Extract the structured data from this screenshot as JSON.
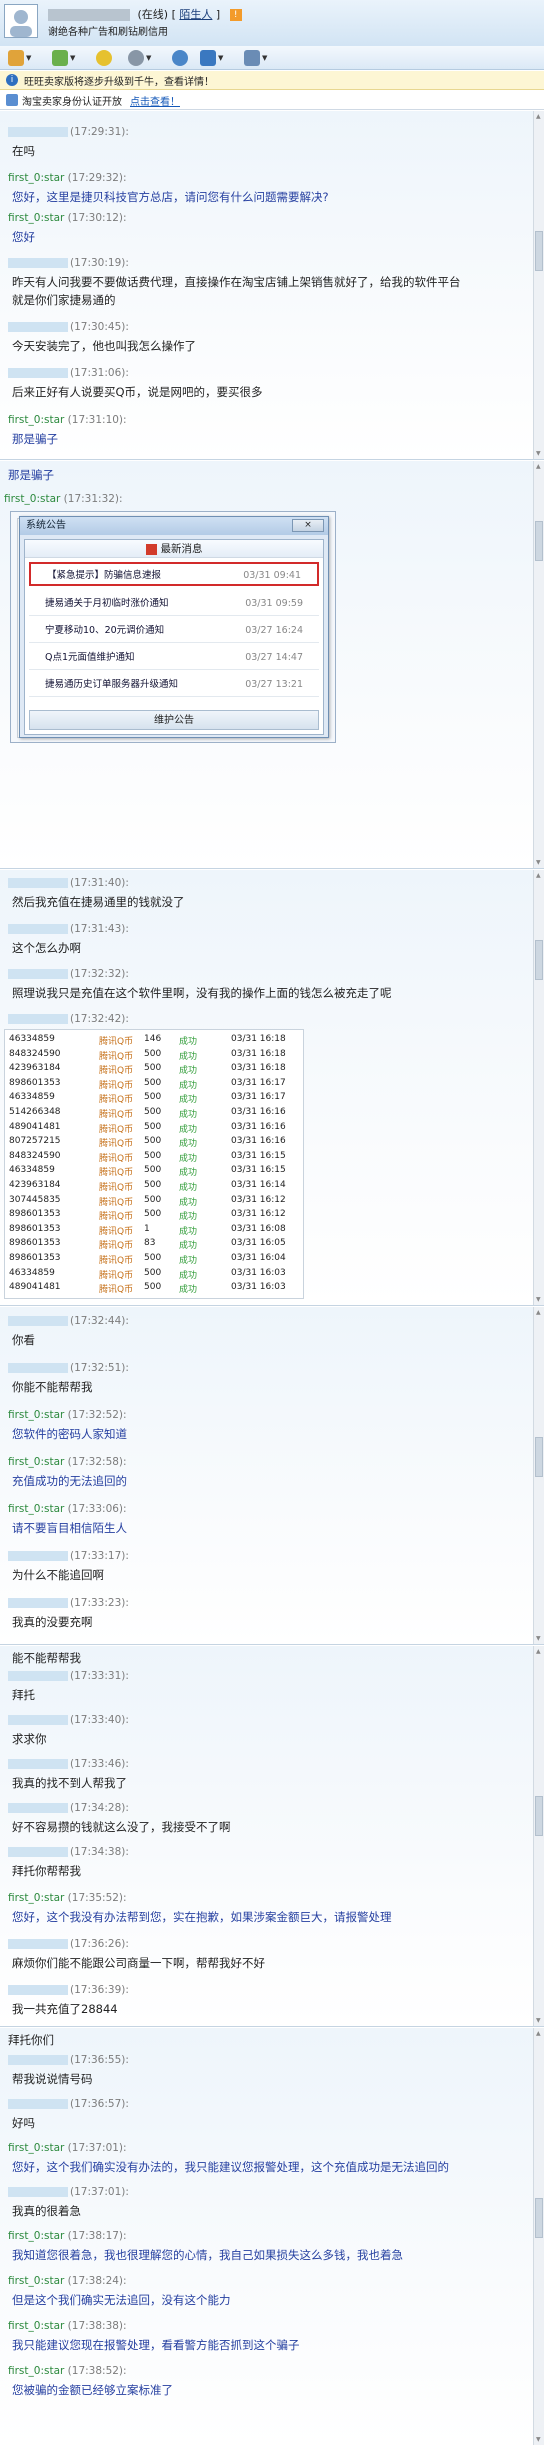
{
  "header": {
    "status": "(在线)",
    "stranger_label": "陌生人",
    "signature": "谢绝各种广告和刷钻刷信用"
  },
  "banner": {
    "text": "旺旺卖家版将逐步升级到千牛，查看详情！"
  },
  "banner2": {
    "text": "淘宝卖家身份认证开放",
    "link": "点击查看！"
  },
  "sections": [
    {
      "messages": [
        {
          "sender": "",
          "time": "(17:29:31):",
          "text": "在吗",
          "role": "me"
        },
        {
          "sender": "first_0:star",
          "time": "(17:29:32):",
          "text": "您好，这里是捷贝科技官方总店，请问您有什么问题需要解决?",
          "role": "star"
        },
        {
          "sender": "first_0:star",
          "time": "(17:30:12):",
          "text": "您好",
          "role": "star"
        },
        {
          "sender": "",
          "time": "(17:30:19):",
          "text": "昨天有人问我要不要做话费代理，直接操作在淘宝店铺上架销售就好了，给我的软件平台",
          "text2": "就是你们家捷易通的",
          "role": "me"
        },
        {
          "sender": "",
          "time": "(17:30:45):",
          "text": "今天安装完了，他也叫我怎么操作了",
          "role": "me"
        },
        {
          "sender": "",
          "time": "(17:31:06):",
          "text": "后来正好有人说要买Q币，说是网吧的，要买很多",
          "role": "me"
        },
        {
          "sender": "first_0:star",
          "time": "(17:31:10):",
          "text": "那是骗子",
          "role": "star"
        }
      ]
    },
    {
      "messages": [
        {
          "text": "那是骗子",
          "role": "star-text"
        },
        {
          "sender": "first_0:star",
          "time": "(17:31:32):",
          "role": "star"
        }
      ],
      "popup": {
        "title": "系统公告",
        "close": "×",
        "head": "最新消息",
        "foot": "维护公告",
        "items": [
          {
            "title": "【紧急提示】防骗信息速报",
            "date": "03/31 09:41"
          },
          {
            "title": "捷易通关于月初临时涨价通知",
            "date": "03/31 09:59"
          },
          {
            "title": "宁夏移动10、20元调价通知",
            "date": "03/27 16:24"
          },
          {
            "title": "Q点1元面值维护通知",
            "date": "03/27 14:47"
          },
          {
            "title": "捷易通历史订单服务器升级通知",
            "date": "03/27 13:21"
          }
        ]
      }
    },
    {
      "messages": [
        {
          "sender": "",
          "time": "(17:31:40):",
          "text": "然后我充值在捷易通里的钱就没了",
          "role": "me"
        },
        {
          "sender": "",
          "time": "(17:31:43):",
          "text": "这个怎么办啊",
          "role": "me"
        },
        {
          "sender": "",
          "time": "(17:32:32):",
          "text": "照理说我只是充值在这个软件里啊，没有我的操作上面的钱怎么被充走了呢",
          "role": "me"
        },
        {
          "sender": "",
          "time": "(17:32:42):",
          "role": "me"
        }
      ],
      "table": [
        [
          "46334859",
          "腾讯Q币",
          "146",
          "成功",
          "03/31 16:18"
        ],
        [
          "848324590",
          "腾讯Q币",
          "500",
          "成功",
          "03/31 16:18"
        ],
        [
          "423963184",
          "腾讯Q币",
          "500",
          "成功",
          "03/31 16:18"
        ],
        [
          "898601353",
          "腾讯Q币",
          "500",
          "成功",
          "03/31 16:17"
        ],
        [
          "46334859",
          "腾讯Q币",
          "500",
          "成功",
          "03/31 16:17"
        ],
        [
          "514266348",
          "腾讯Q币",
          "500",
          "成功",
          "03/31 16:16"
        ],
        [
          "489041481",
          "腾讯Q币",
          "500",
          "成功",
          "03/31 16:16"
        ],
        [
          "807257215",
          "腾讯Q币",
          "500",
          "成功",
          "03/31 16:16"
        ],
        [
          "848324590",
          "腾讯Q币",
          "500",
          "成功",
          "03/31 16:15"
        ],
        [
          "46334859",
          "腾讯Q币",
          "500",
          "成功",
          "03/31 16:15"
        ],
        [
          "423963184",
          "腾讯Q币",
          "500",
          "成功",
          "03/31 16:14"
        ],
        [
          "307445835",
          "腾讯Q币",
          "500",
          "成功",
          "03/31 16:12"
        ],
        [
          "898601353",
          "腾讯Q币",
          "500",
          "成功",
          "03/31 16:12"
        ],
        [
          "898601353",
          "腾讯Q币",
          "1",
          "成功",
          "03/31 16:08"
        ],
        [
          "898601353",
          "腾讯Q币",
          "83",
          "成功",
          "03/31 16:05"
        ],
        [
          "898601353",
          "腾讯Q币",
          "500",
          "成功",
          "03/31 16:04"
        ],
        [
          "46334859",
          "腾讯Q币",
          "500",
          "成功",
          "03/31 16:03"
        ],
        [
          "489041481",
          "腾讯Q币",
          "500",
          "成功",
          "03/31 16:03"
        ]
      ]
    },
    {
      "messages": [
        {
          "sender": "",
          "time": "(17:32:44):",
          "text": "你看",
          "role": "me"
        },
        {
          "sender": "",
          "time": "(17:32:51):",
          "text": "你能不能帮帮我",
          "role": "me"
        },
        {
          "sender": "first_0:star",
          "time": "(17:32:52):",
          "text": "您软件的密码人家知道",
          "role": "star"
        },
        {
          "sender": "first_0:star",
          "time": "(17:32:58):",
          "text": "充值成功的无法追回的",
          "role": "star"
        },
        {
          "sender": "first_0:star",
          "time": "(17:33:06):",
          "text": "请不要盲目相信陌生人",
          "role": "star"
        },
        {
          "sender": "",
          "time": "(17:33:17):",
          "text": "为什么不能追回啊",
          "role": "me"
        },
        {
          "sender": "",
          "time": "(17:33:23):",
          "text": "我真的没要充啊",
          "role": "me"
        }
      ]
    },
    {
      "messages": [
        {
          "text": "能不能帮帮我",
          "role": "me-text"
        },
        {
          "sender": "",
          "time": "(17:33:31):",
          "text": "拜托",
          "role": "me"
        },
        {
          "sender": "",
          "time": "(17:33:40):",
          "text": "求求你",
          "role": "me"
        },
        {
          "sender": "",
          "time": "(17:33:46):",
          "text": "我真的找不到人帮我了",
          "role": "me"
        },
        {
          "sender": "",
          "time": "(17:34:28):",
          "text": "好不容易攒的钱就这么没了，我接受不了啊",
          "role": "me"
        },
        {
          "sender": "",
          "time": "(17:34:38):",
          "text": "拜托你帮帮我",
          "role": "me"
        },
        {
          "sender": "first_0:star",
          "time": "(17:35:52):",
          "text": "您好，这个我没有办法帮到您，实在抱歉，如果涉案金额巨大，请报警处理",
          "role": "star"
        },
        {
          "sender": "",
          "time": "(17:36:26):",
          "text": "麻烦你们能不能跟公司商量一下啊，帮帮我好不好",
          "role": "me"
        },
        {
          "sender": "",
          "time": "(17:36:39):",
          "text": "我一共充值了28844",
          "role": "me"
        }
      ]
    },
    {
      "messages": [
        {
          "text": "拜托你们",
          "role": "me-text"
        },
        {
          "sender": "",
          "time": "(17:36:55):",
          "text": "帮我说说情号码",
          "role": "me"
        },
        {
          "sender": "",
          "time": "(17:36:57):",
          "text": "好吗",
          "role": "me"
        },
        {
          "sender": "first_0:star",
          "time": "(17:37:01):",
          "text": "您好，这个我们确实没有办法的，我只能建议您报警处理，这个充值成功是无法追回的",
          "role": "star"
        },
        {
          "sender": "",
          "time": "(17:37:01):",
          "text": "我真的很着急",
          "role": "me"
        },
        {
          "sender": "first_0:star",
          "time": "(17:38:17):",
          "text": "我知道您很着急，我也很理解您的心情，我自己如果损失这么多钱，我也着急",
          "role": "star"
        },
        {
          "sender": "first_0:star",
          "time": "(17:38:24):",
          "text": "但是这个我们确实无法追回，没有这个能力",
          "role": "star"
        },
        {
          "sender": "first_0:star",
          "time": "(17:38:38):",
          "text": "我只能建议您现在报警处理，看看警方能否抓到这个骗子",
          "role": "star"
        },
        {
          "sender": "first_0:star",
          "time": "(17:38:52):",
          "text": "您被骗的金额已经够立案标准了",
          "role": "star"
        }
      ]
    }
  ],
  "colors": {
    "star_name": "#2d8a3e",
    "star_text": "#253fa0",
    "time": "#7c7c7c",
    "highlight": "#d22a2a",
    "success": "#2e9b36",
    "qb": "#c6711a"
  }
}
